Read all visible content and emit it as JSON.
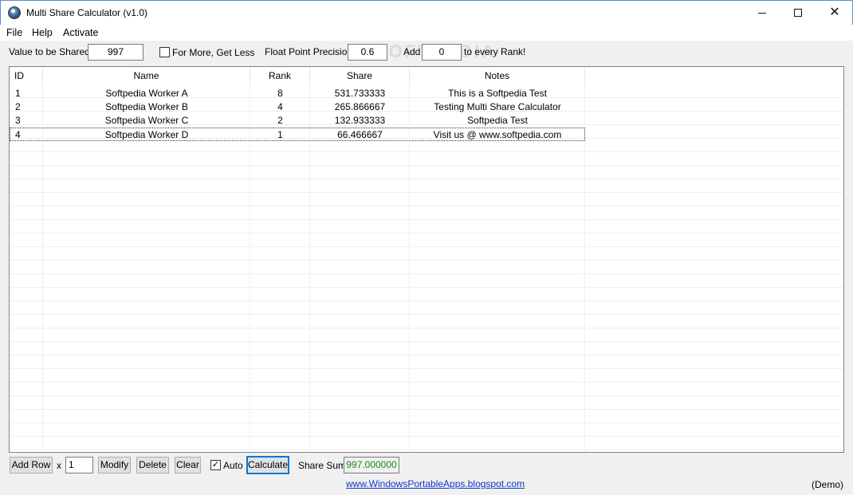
{
  "window": {
    "title": "Multi Share Calculator (v1.0)",
    "controls": {
      "minimize": "—",
      "maximize": "☐",
      "close": "✕"
    }
  },
  "menu": [
    "File",
    "Help",
    "Activate"
  ],
  "watermark": "SOFTPEDIA",
  "toolbar": {
    "value_label": "Value to be Shared:",
    "value": "997",
    "for_more_label": "For More, Get Less",
    "for_more_checked": false,
    "precision_label": "Float Point Precision:",
    "precision": "0.6",
    "add_label": "Add",
    "add_value": "0",
    "add_suffix": "to every Rank!"
  },
  "grid": {
    "columns": [
      "ID",
      "Name",
      "Rank",
      "Share",
      "Notes"
    ],
    "rows": [
      {
        "id": "1",
        "name": "Softpedia Worker A",
        "rank": "8",
        "share": "531.733333",
        "notes": "This is a Softpedia Test"
      },
      {
        "id": "2",
        "name": "Softpedia Worker B",
        "rank": "4",
        "share": "265.866667",
        "notes": "Testing Multi Share Calculator"
      },
      {
        "id": "3",
        "name": "Softpedia Worker C",
        "rank": "2",
        "share": "132.933333",
        "notes": "Softpedia Test"
      },
      {
        "id": "4",
        "name": "Softpedia Worker D",
        "rank": "1",
        "share": "66.466667",
        "notes": "Visit us @ www.softpedia.com"
      }
    ]
  },
  "bottom": {
    "add_row": "Add Row",
    "x_label": "x",
    "count": "1",
    "modify": "Modify",
    "delete": "Delete",
    "clear": "Clear",
    "auto_label": "Auto",
    "auto_checked": true,
    "calculate": "Calculate",
    "sum_label": "Share Sum",
    "sum_value": "997.000000"
  },
  "footer": {
    "link": "www.WindowsPortableApps.blogspot.com",
    "status": "(Demo)"
  }
}
